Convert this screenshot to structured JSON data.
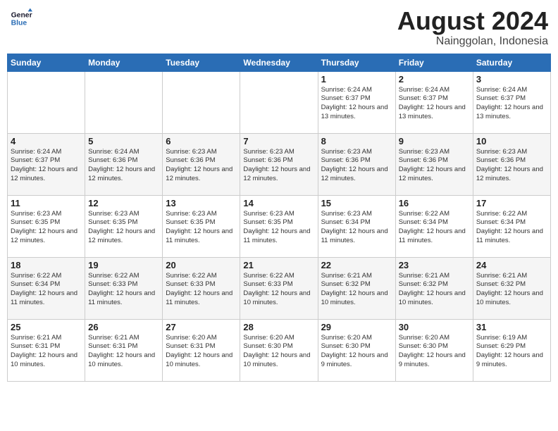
{
  "header": {
    "logo_line1": "General",
    "logo_line2": "Blue",
    "month_year": "August 2024",
    "location": "Nainggolan, Indonesia"
  },
  "weekdays": [
    "Sunday",
    "Monday",
    "Tuesday",
    "Wednesday",
    "Thursday",
    "Friday",
    "Saturday"
  ],
  "weeks": [
    [
      {
        "day": "",
        "info": ""
      },
      {
        "day": "",
        "info": ""
      },
      {
        "day": "",
        "info": ""
      },
      {
        "day": "",
        "info": ""
      },
      {
        "day": "1",
        "info": "Sunrise: 6:24 AM\nSunset: 6:37 PM\nDaylight: 12 hours\nand 13 minutes."
      },
      {
        "day": "2",
        "info": "Sunrise: 6:24 AM\nSunset: 6:37 PM\nDaylight: 12 hours\nand 13 minutes."
      },
      {
        "day": "3",
        "info": "Sunrise: 6:24 AM\nSunset: 6:37 PM\nDaylight: 12 hours\nand 13 minutes."
      }
    ],
    [
      {
        "day": "4",
        "info": "Sunrise: 6:24 AM\nSunset: 6:37 PM\nDaylight: 12 hours\nand 12 minutes."
      },
      {
        "day": "5",
        "info": "Sunrise: 6:24 AM\nSunset: 6:36 PM\nDaylight: 12 hours\nand 12 minutes."
      },
      {
        "day": "6",
        "info": "Sunrise: 6:23 AM\nSunset: 6:36 PM\nDaylight: 12 hours\nand 12 minutes."
      },
      {
        "day": "7",
        "info": "Sunrise: 6:23 AM\nSunset: 6:36 PM\nDaylight: 12 hours\nand 12 minutes."
      },
      {
        "day": "8",
        "info": "Sunrise: 6:23 AM\nSunset: 6:36 PM\nDaylight: 12 hours\nand 12 minutes."
      },
      {
        "day": "9",
        "info": "Sunrise: 6:23 AM\nSunset: 6:36 PM\nDaylight: 12 hours\nand 12 minutes."
      },
      {
        "day": "10",
        "info": "Sunrise: 6:23 AM\nSunset: 6:36 PM\nDaylight: 12 hours\nand 12 minutes."
      }
    ],
    [
      {
        "day": "11",
        "info": "Sunrise: 6:23 AM\nSunset: 6:35 PM\nDaylight: 12 hours\nand 12 minutes."
      },
      {
        "day": "12",
        "info": "Sunrise: 6:23 AM\nSunset: 6:35 PM\nDaylight: 12 hours\nand 12 minutes."
      },
      {
        "day": "13",
        "info": "Sunrise: 6:23 AM\nSunset: 6:35 PM\nDaylight: 12 hours\nand 11 minutes."
      },
      {
        "day": "14",
        "info": "Sunrise: 6:23 AM\nSunset: 6:35 PM\nDaylight: 12 hours\nand 11 minutes."
      },
      {
        "day": "15",
        "info": "Sunrise: 6:23 AM\nSunset: 6:34 PM\nDaylight: 12 hours\nand 11 minutes."
      },
      {
        "day": "16",
        "info": "Sunrise: 6:22 AM\nSunset: 6:34 PM\nDaylight: 12 hours\nand 11 minutes."
      },
      {
        "day": "17",
        "info": "Sunrise: 6:22 AM\nSunset: 6:34 PM\nDaylight: 12 hours\nand 11 minutes."
      }
    ],
    [
      {
        "day": "18",
        "info": "Sunrise: 6:22 AM\nSunset: 6:34 PM\nDaylight: 12 hours\nand 11 minutes."
      },
      {
        "day": "19",
        "info": "Sunrise: 6:22 AM\nSunset: 6:33 PM\nDaylight: 12 hours\nand 11 minutes."
      },
      {
        "day": "20",
        "info": "Sunrise: 6:22 AM\nSunset: 6:33 PM\nDaylight: 12 hours\nand 11 minutes."
      },
      {
        "day": "21",
        "info": "Sunrise: 6:22 AM\nSunset: 6:33 PM\nDaylight: 12 hours\nand 10 minutes."
      },
      {
        "day": "22",
        "info": "Sunrise: 6:21 AM\nSunset: 6:32 PM\nDaylight: 12 hours\nand 10 minutes."
      },
      {
        "day": "23",
        "info": "Sunrise: 6:21 AM\nSunset: 6:32 PM\nDaylight: 12 hours\nand 10 minutes."
      },
      {
        "day": "24",
        "info": "Sunrise: 6:21 AM\nSunset: 6:32 PM\nDaylight: 12 hours\nand 10 minutes."
      }
    ],
    [
      {
        "day": "25",
        "info": "Sunrise: 6:21 AM\nSunset: 6:31 PM\nDaylight: 12 hours\nand 10 minutes."
      },
      {
        "day": "26",
        "info": "Sunrise: 6:21 AM\nSunset: 6:31 PM\nDaylight: 12 hours\nand 10 minutes."
      },
      {
        "day": "27",
        "info": "Sunrise: 6:20 AM\nSunset: 6:31 PM\nDaylight: 12 hours\nand 10 minutes."
      },
      {
        "day": "28",
        "info": "Sunrise: 6:20 AM\nSunset: 6:30 PM\nDaylight: 12 hours\nand 10 minutes."
      },
      {
        "day": "29",
        "info": "Sunrise: 6:20 AM\nSunset: 6:30 PM\nDaylight: 12 hours\nand 9 minutes."
      },
      {
        "day": "30",
        "info": "Sunrise: 6:20 AM\nSunset: 6:30 PM\nDaylight: 12 hours\nand 9 minutes."
      },
      {
        "day": "31",
        "info": "Sunrise: 6:19 AM\nSunset: 6:29 PM\nDaylight: 12 hours\nand 9 minutes."
      }
    ]
  ]
}
